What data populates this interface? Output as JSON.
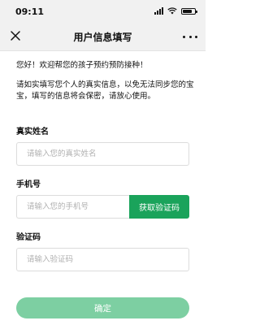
{
  "status_bar": {
    "time": "09:11"
  },
  "nav": {
    "title": "用户信息填写"
  },
  "intro": {
    "line1": "您好！欢迎帮您的孩子预约预防接种！",
    "line2": "请如实填写您个人的真实信息，以免无法同步您的宝宝，填写的信息将会保密，请放心使用。"
  },
  "form": {
    "name": {
      "label": "真实姓名",
      "placeholder": "请输入您的真实姓名"
    },
    "phone": {
      "label": "手机号",
      "placeholder": "请输入您的手机号",
      "get_code_label": "获取验证码"
    },
    "code": {
      "label": "验证码",
      "placeholder": "请输入验证码"
    },
    "submit_label": "确定"
  },
  "colors": {
    "accent": "#1aa35b",
    "submit_disabled": "#7dcfa2",
    "bar_bg": "#f1f1f1"
  },
  "icons": [
    "close-icon",
    "more-icon",
    "signal-icon",
    "wifi-icon",
    "battery-icon"
  ]
}
